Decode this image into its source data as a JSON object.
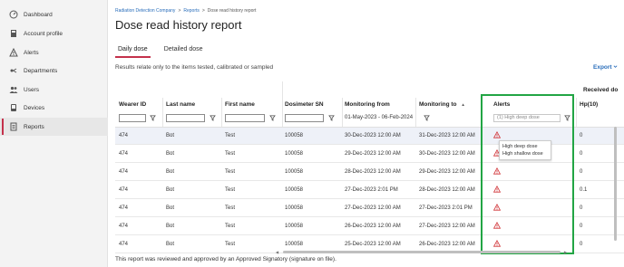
{
  "sidebar": {
    "items": [
      {
        "label": "Dashboard",
        "icon": "dashboard-icon"
      },
      {
        "label": "Account profile",
        "icon": "account-profile-icon"
      },
      {
        "label": "Alerts",
        "icon": "alert-icon"
      },
      {
        "label": "Departments",
        "icon": "departments-icon"
      },
      {
        "label": "Users",
        "icon": "users-icon"
      },
      {
        "label": "Devices",
        "icon": "devices-icon"
      },
      {
        "label": "Reports",
        "icon": "reports-icon",
        "active": true
      }
    ]
  },
  "breadcrumb": {
    "company": "Radiation Detection Company",
    "sep1": ">",
    "reports": "Reports",
    "sep2": ">",
    "current": "Dose read history report"
  },
  "page": {
    "title": "Dose read history report",
    "note": "Results relate only to the items tested, calibrated or sampled",
    "export_label": "Export",
    "footer": "This report was reviewed and approved by an Approved Signatory (signature on file)."
  },
  "tabs": [
    {
      "label": "Daily dose",
      "active": true
    },
    {
      "label": "Detailed dose",
      "active": false
    }
  ],
  "table": {
    "group_header": "Received do",
    "headers": {
      "wearer_id": "Wearer ID",
      "last_name": "Last name",
      "first_name": "First name",
      "dosimeter_sn": "Dosimeter SN",
      "monitoring_from": "Monitoring from",
      "monitoring_to": "Monitoring to",
      "sort_indicator": "▲",
      "alerts": "Alerts",
      "hp10": "Hp(10)"
    },
    "filters": {
      "monitoring_from_value": "01-May-2023 - 06-Feb-2024",
      "alerts_placeholder": "(1) High deep dose"
    },
    "rows": [
      {
        "wearer_id": "474",
        "last_name": "Bot",
        "first_name": "Test",
        "sn": "100058",
        "from": "30-Dec-2023 12:00 AM",
        "to": "31-Dec-2023 12:00 AM",
        "hp10": "0"
      },
      {
        "wearer_id": "474",
        "last_name": "Bot",
        "first_name": "Test",
        "sn": "100058",
        "from": "29-Dec-2023 12:00 AM",
        "to": "30-Dec-2023 12:00 AM",
        "hp10": "0"
      },
      {
        "wearer_id": "474",
        "last_name": "Bot",
        "first_name": "Test",
        "sn": "100058",
        "from": "28-Dec-2023 12:00 AM",
        "to": "29-Dec-2023 12:00 AM",
        "hp10": "0"
      },
      {
        "wearer_id": "474",
        "last_name": "Bot",
        "first_name": "Test",
        "sn": "100058",
        "from": "27-Dec-2023 2:01 PM",
        "to": "28-Dec-2023 12:00 AM",
        "hp10": "0.1"
      },
      {
        "wearer_id": "474",
        "last_name": "Bot",
        "first_name": "Test",
        "sn": "100058",
        "from": "27-Dec-2023 12:00 AM",
        "to": "27-Dec-2023 2:01 PM",
        "hp10": "0"
      },
      {
        "wearer_id": "474",
        "last_name": "Bot",
        "first_name": "Test",
        "sn": "100058",
        "from": "26-Dec-2023 12:00 AM",
        "to": "27-Dec-2023 12:00 AM",
        "hp10": "0"
      },
      {
        "wearer_id": "474",
        "last_name": "Bot",
        "first_name": "Test",
        "sn": "100058",
        "from": "25-Dec-2023 12:00 AM",
        "to": "26-Dec-2023 12:00 AM",
        "hp10": "0"
      }
    ]
  },
  "tooltip": {
    "line1": "High deep dose",
    "line2": "High shallow dose"
  },
  "colors": {
    "accent": "#c4314b",
    "link": "#2a6ebb",
    "alert_red": "#d13438",
    "highlight_green": "#22a544"
  }
}
